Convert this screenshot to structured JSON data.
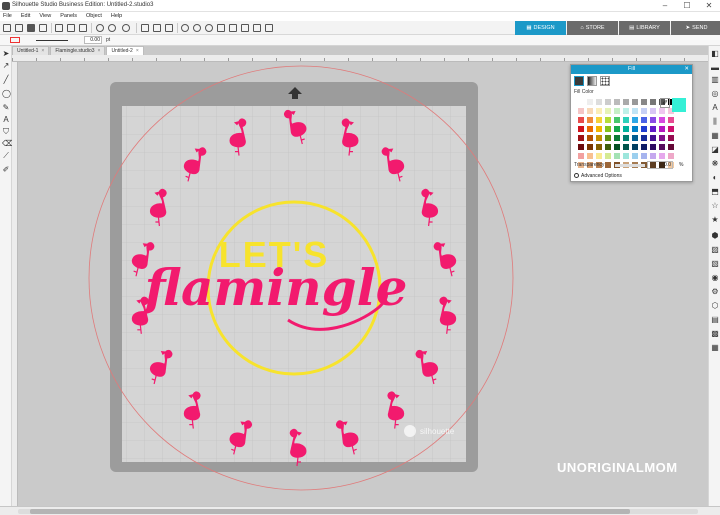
{
  "window": {
    "title": "Silhouette Studio Business Edition: Untitled-2.studio3",
    "minimize": "–",
    "maximize": "☐",
    "close": "✕"
  },
  "menu": [
    "File",
    "Edit",
    "View",
    "Panels",
    "Object",
    "Help"
  ],
  "nav_tabs": [
    {
      "label": "DESIGN",
      "glyph": "▦",
      "active": true
    },
    {
      "label": "STORE",
      "glyph": "⌂",
      "active": false
    },
    {
      "label": "LIBRARY",
      "glyph": "▤",
      "active": false
    },
    {
      "label": "SEND",
      "glyph": "➤",
      "active": false
    }
  ],
  "line_settings": {
    "line_weight": "0.00",
    "unit": "pt"
  },
  "doc_tabs": [
    {
      "label": "Untitled-1",
      "active": false
    },
    {
      "label": "Flamingle.studio3",
      "active": false
    },
    {
      "label": "Untitled-2",
      "active": true
    }
  ],
  "design": {
    "top_text": "LET'S",
    "script_text": "flamingle",
    "brand_mark": "silhouette",
    "colors": {
      "flamingo": "#f21a6e",
      "yellow": "#f7e32c",
      "mat": "#999999",
      "cut_area": "#d5d5d5",
      "guide": "#e07a7a"
    }
  },
  "fill_panel": {
    "title": "Fill",
    "close": "✕",
    "section_label": "Fill Color",
    "transparency_label": "Transparency",
    "transparency_value": "0.0",
    "transparency_unit": "%",
    "advanced_label": "Advanced Options",
    "selected_color": "#35f0d6",
    "palette": [
      "#ffffff",
      "#eeeeee",
      "#dddddd",
      "#cccccc",
      "#bbbbbb",
      "#aaaaaa",
      "#999999",
      "#888888",
      "#777777",
      "#555555",
      "#000000",
      "#f5c6c6",
      "#f8d9b8",
      "#fbeeb8",
      "#e6f3b8",
      "#c6efc6",
      "#bff0e8",
      "#c0e4f5",
      "#c6d0f5",
      "#d8c6f5",
      "#efc6f0",
      "#f5c6dc",
      "#e94b4b",
      "#f08a3c",
      "#f6d23a",
      "#b5dd3a",
      "#47c76b",
      "#2fd1bb",
      "#2fa8e6",
      "#4a62e6",
      "#8a4ae6",
      "#d74ae0",
      "#e64a93",
      "#d0121b",
      "#ea6a00",
      "#f2b600",
      "#84c21b",
      "#13a84a",
      "#00b29c",
      "#0082c8",
      "#1f3dd1",
      "#6118c9",
      "#b515c0",
      "#cf0f6e",
      "#9e0f14",
      "#b34f00",
      "#c48f00",
      "#5e8f12",
      "#0a7a34",
      "#007d6e",
      "#005d91",
      "#142a99",
      "#440f91",
      "#82108a",
      "#960b50",
      "#6a0a0d",
      "#783500",
      "#836000",
      "#3f600c",
      "#055122",
      "#00544a",
      "#003e61",
      "#0d1c66",
      "#2d0a61",
      "#570b5c",
      "#640736",
      "#f2a0a0",
      "#f8c091",
      "#faea94",
      "#d5ea94",
      "#a4e2b4",
      "#9de6dc",
      "#9ccfee",
      "#a6b4ee",
      "#c5a8ee",
      "#e6a8ec",
      "#eea8c8",
      "#e9b58c",
      "#d49a6a",
      "#b8804f",
      "#9c673a",
      "#7f5027",
      "#c9a27a",
      "#a67c52",
      "#825a34",
      "#5e3e22",
      "#3d2714",
      "#f2c9a0"
    ]
  },
  "watermark": "UNORIGINALMOM",
  "left_tools": [
    "select-arrow",
    "point-edit",
    "line",
    "ellipse",
    "pencil",
    "text",
    "eraser",
    "knife",
    "eyedropper"
  ],
  "right_tools": [
    "fill",
    "line-color",
    "gradient",
    "shadow",
    "text-style",
    "align",
    "replicate",
    "modify",
    "offset",
    "trace",
    "transform",
    "library",
    "store",
    "favorites",
    "points",
    "send",
    "layers",
    "web",
    "rhinestone",
    "sketch",
    "print",
    "cut",
    "images"
  ]
}
